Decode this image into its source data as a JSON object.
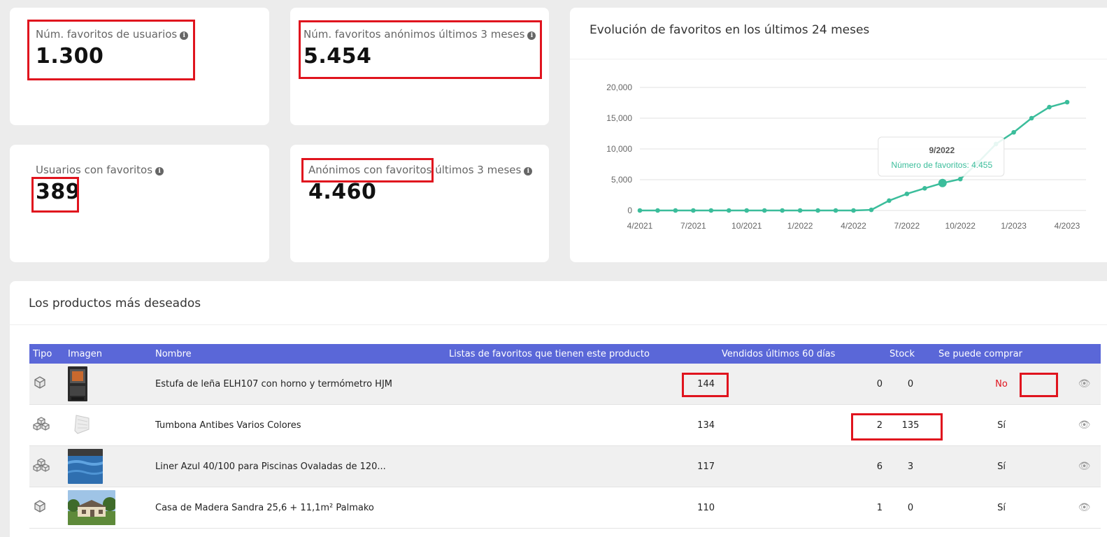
{
  "kpis": {
    "user_favs": {
      "label": "Núm. favoritos de usuarios",
      "value": "1.300"
    },
    "anon_favs": {
      "label": "Núm. favoritos anónimos últimos 3 meses",
      "value": "5.454"
    },
    "users_with_favs": {
      "label": "Usuarios con favoritos",
      "value": "389"
    },
    "anon_with_favs": {
      "label": "Anónimos con favoritos",
      "label_suffix": " últimos 3 meses",
      "value": "4.460"
    }
  },
  "chart": {
    "title": "Evolución de favoritos en los últimos 24 meses",
    "tooltip": {
      "title": "9/2022",
      "text": "Número de favoritos: 4.455"
    }
  },
  "chart_data": {
    "type": "line",
    "title": "Evolución de favoritos en los últimos 24 meses",
    "x": [
      "4/2021",
      "5/2021",
      "6/2021",
      "7/2021",
      "8/2021",
      "9/2021",
      "10/2021",
      "11/2021",
      "12/2021",
      "1/2022",
      "2/2022",
      "3/2022",
      "4/2022",
      "5/2022",
      "6/2022",
      "7/2022",
      "8/2022",
      "9/2022",
      "10/2022",
      "11/2022",
      "12/2022",
      "1/2023",
      "2/2023",
      "3/2023",
      "4/2023"
    ],
    "x_ticks": [
      "4/2021",
      "7/2021",
      "10/2021",
      "1/2022",
      "4/2022",
      "7/2022",
      "10/2022",
      "1/2023",
      "4/2023"
    ],
    "y_ticks": [
      "0",
      "5,000",
      "10,000",
      "15,000",
      "20,000"
    ],
    "series": [
      {
        "values": [
          0,
          0,
          0,
          0,
          0,
          0,
          0,
          0,
          0,
          0,
          0,
          0,
          0,
          100,
          1600,
          2700,
          3600,
          4455,
          5100,
          7800,
          10800,
          12700,
          15000,
          16800,
          17600
        ],
        "color": "#3bbd9b"
      }
    ],
    "ylim": [
      0,
      20000
    ],
    "grid": true,
    "highlight_index": 17
  },
  "products": {
    "title": "Los productos más deseados",
    "columns": [
      "Tipo",
      "Imagen",
      "Nombre",
      "Listas de favoritos que tienen este producto",
      "Vendidos últimos 60 días",
      "Stock",
      "Se puede comprar"
    ],
    "rows": [
      {
        "type_icon": "single-box-icon",
        "name": "Estufa de leña ELH107 con horno y termómetro HJM",
        "lists": "144",
        "sold": "0",
        "stock": "0",
        "buyable": "No"
      },
      {
        "type_icon": "multi-box-icon",
        "name": "Tumbona Antibes Varios Colores",
        "lists": "134",
        "sold": "2",
        "stock": "135",
        "buyable": "Sí"
      },
      {
        "type_icon": "multi-box-icon",
        "name": "Liner Azul 40/100 para Piscinas Ovaladas de 120...",
        "lists": "117",
        "sold": "6",
        "stock": "3",
        "buyable": "Sí"
      },
      {
        "type_icon": "single-box-icon",
        "name": "Casa de Madera Sandra 25,6 + 11,1m² Palmako",
        "lists": "110",
        "sold": "1",
        "stock": "0",
        "buyable": "Sí"
      }
    ]
  }
}
